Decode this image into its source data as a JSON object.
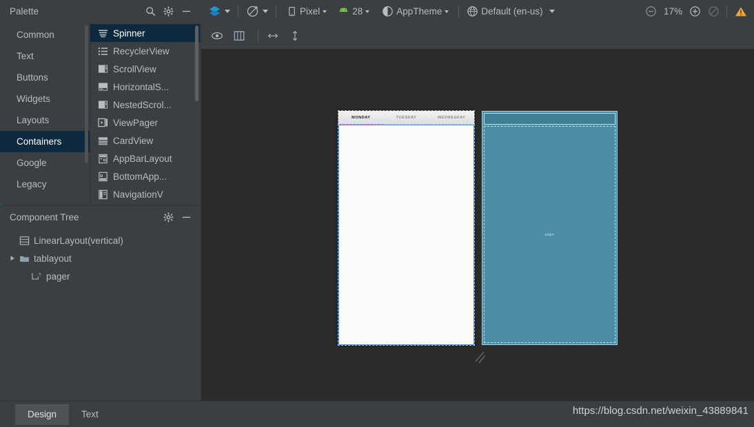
{
  "palette": {
    "title": "Palette",
    "icons": [
      "search-icon",
      "gear-icon",
      "minimize-icon"
    ],
    "categories": [
      {
        "label": "Common",
        "selected": false
      },
      {
        "label": "Text",
        "selected": false
      },
      {
        "label": "Buttons",
        "selected": false
      },
      {
        "label": "Widgets",
        "selected": false
      },
      {
        "label": "Layouts",
        "selected": false
      },
      {
        "label": "Containers",
        "selected": true
      },
      {
        "label": "Google",
        "selected": false
      },
      {
        "label": "Legacy",
        "selected": false
      }
    ],
    "items": [
      {
        "label": "Spinner",
        "icon": "spinner-icon",
        "selected": true
      },
      {
        "label": "RecyclerView",
        "icon": "recyclerview-icon",
        "selected": false
      },
      {
        "label": "ScrollView",
        "icon": "scrollview-icon",
        "selected": false
      },
      {
        "label": "HorizontalS...",
        "icon": "horizontalscrollview-icon",
        "selected": false
      },
      {
        "label": "NestedScrol...",
        "icon": "nestedscrollview-icon",
        "selected": false
      },
      {
        "label": "ViewPager",
        "icon": "viewpager-icon",
        "selected": false
      },
      {
        "label": "CardView",
        "icon": "cardview-icon",
        "selected": false
      },
      {
        "label": "AppBarLayout",
        "icon": "appbarlayout-icon",
        "selected": false
      },
      {
        "label": "BottomApp...",
        "icon": "bottomappbar-icon",
        "selected": false
      },
      {
        "label": "NavigationV",
        "icon": "navigationview-icon",
        "selected": false
      }
    ]
  },
  "component_tree": {
    "title": "Component Tree",
    "icons": [
      "gear-icon",
      "minimize-icon"
    ],
    "nodes": [
      {
        "label": "LinearLayout",
        "suffix": "(vertical)",
        "icon": "linearlayout-icon",
        "indent": 0,
        "expandable": false
      },
      {
        "label": "tablayout",
        "suffix": "",
        "icon": "folder-icon",
        "indent": 0,
        "expandable": true
      },
      {
        "label": "pager",
        "suffix": "",
        "icon": "viewpager-node-icon",
        "indent": 1,
        "expandable": false
      }
    ]
  },
  "toolbar": {
    "design_surface_label": "",
    "orientation_label": "",
    "device_label": "Pixel",
    "api_label": "28",
    "theme_label": "AppTheme",
    "locale_label": "Default (en-us)",
    "zoom_level": "17%",
    "zoom_out_icon": "zoom-out-icon",
    "zoom_in_icon": "zoom-in-icon",
    "zoom_fit_icon": "zoom-fit-icon",
    "warning_icon": "warning-icon",
    "layers_icon": "layers-icon",
    "rotate_icon": "rotate-icon",
    "device_icon": "phone-icon",
    "api_icon": "android-icon",
    "theme_icon": "theme-contrast-icon",
    "locale_icon": "globe-icon"
  },
  "editor_toolbar": {
    "buttons": [
      {
        "icon": "eye-icon",
        "name": "show-design-icon"
      },
      {
        "icon": "columns-icon",
        "name": "blueprint-mode-icon"
      },
      {
        "icon": "horizontal-arrow-icon",
        "name": "match-width-icon"
      },
      {
        "icon": "vertical-arrow-icon",
        "name": "match-height-icon"
      }
    ]
  },
  "preview": {
    "tabs": [
      {
        "label": "MONDAY",
        "active": true
      },
      {
        "label": "TUESDAY",
        "active": false
      },
      {
        "label": "WEDNESDAY",
        "active": false
      }
    ],
    "blueprint_label": "pager",
    "accent_color": "#4a90d9",
    "tab_indicator_color": "#e8607d",
    "blueprint_fill": "#4d8da3",
    "blueprint_stroke": "#9fd4e8"
  },
  "bottom_tabs": [
    {
      "label": "Design",
      "selected": true
    },
    {
      "label": "Text",
      "selected": false
    }
  ],
  "watermark": "https://blog.csdn.net/weixin_43889841"
}
